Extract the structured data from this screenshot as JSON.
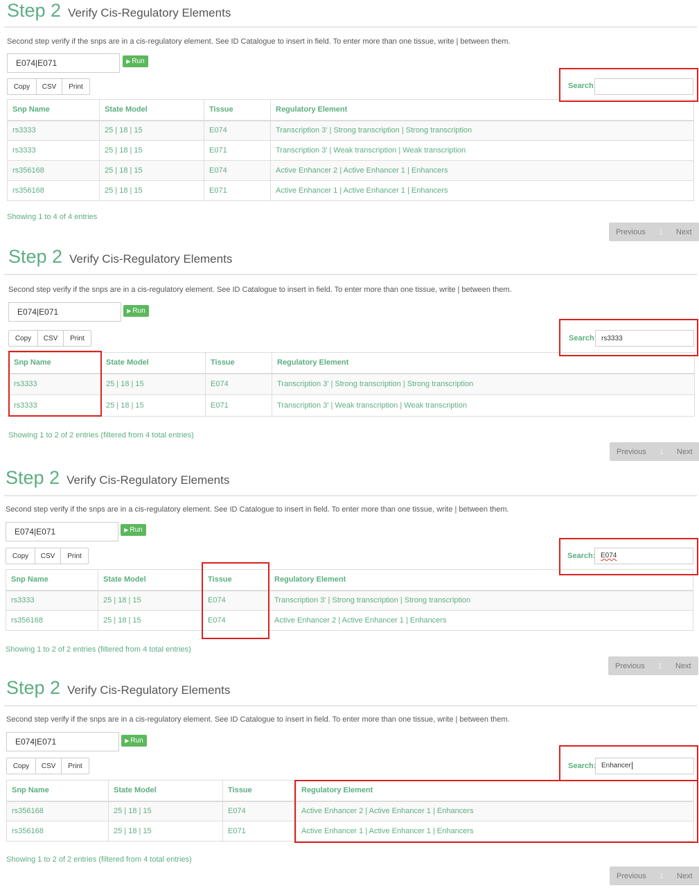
{
  "step": {
    "number": "Step 2",
    "title": "Verify Cis-Regulatory Elements",
    "description": "Second step verify if the snps are in a cis-regulatory element. See ID Catalogue to insert in field. To enter more than one tissue, write | between them.",
    "tissue_value": "E074|E071",
    "run_label": "Run",
    "run_icon": "play-icon"
  },
  "buttons": {
    "copy": "Copy",
    "csv": "CSV",
    "print": "Print"
  },
  "search_label": "Search:",
  "columns": [
    "Snp Name",
    "State Model",
    "Tissue",
    "Regulatory Element"
  ],
  "pagination": {
    "previous": "Previous",
    "page": "1",
    "next": "Next"
  },
  "highlight_color": "#d9211e",
  "accent_color": "#5cae82",
  "panels": [
    {
      "search_value": "",
      "rows": [
        [
          "rs3333",
          "25 | 18 | 15",
          "E074",
          "Transcription 3' | Strong transcription | Strong transcription"
        ],
        [
          "rs3333",
          "25 | 18 | 15",
          "E071",
          "Transcription 3' | Weak transcription | Weak transcription"
        ],
        [
          "rs356168",
          "25 | 18 | 15",
          "E074",
          "Active Enhancer 2 | Active Enhancer 1 | Enhancers"
        ],
        [
          "rs356168",
          "25 | 18 | 15",
          "E071",
          "Active Enhancer 1 | Active Enhancer 1 | Enhancers"
        ]
      ],
      "info": "Showing 1 to 4 of 4 entries"
    },
    {
      "search_value": "rs3333",
      "rows": [
        [
          "rs3333",
          "25 | 18 | 15",
          "E074",
          "Transcription 3' | Strong transcription | Strong transcription"
        ],
        [
          "rs3333",
          "25 | 18 | 15",
          "E071",
          "Transcription 3' | Weak transcription | Weak transcription"
        ]
      ],
      "info": "Showing 1 to 2 of 2 entries (filtered from 4 total entries)"
    },
    {
      "search_value": "E074",
      "rows": [
        [
          "rs3333",
          "25 | 18 | 15",
          "E074",
          "Transcription 3' | Strong transcription | Strong transcription"
        ],
        [
          "rs356168",
          "25 | 18 | 15",
          "E074",
          "Active Enhancer 2 | Active Enhancer 1 | Enhancers"
        ]
      ],
      "info": "Showing 1 to 2 of 2 entries (filtered from 4 total entries)"
    },
    {
      "search_value": "Enhancer",
      "rows": [
        [
          "rs356168",
          "25 | 18 | 15",
          "E074",
          "Active Enhancer 2 | Active Enhancer 1 | Enhancers"
        ],
        [
          "rs356168",
          "25 | 18 | 15",
          "E071",
          "Active Enhancer 1 | Active Enhancer 1 | Enhancers"
        ]
      ],
      "info": "Showing 1 to 2 of 2 entries (filtered from 4 total entries)"
    }
  ]
}
